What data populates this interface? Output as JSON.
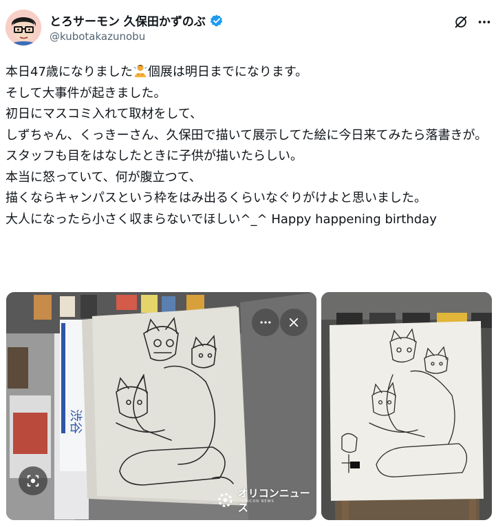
{
  "header": {
    "display_name": "とろサーモン 久保田かずのぶ",
    "handle": "@kubotakazunobu"
  },
  "tweet": {
    "line1_before_emoji": "本日47歳になりました",
    "line1_after_emoji": "個展は明日までになります。",
    "line2": "そして大事件が起きました。",
    "line3": "初日にマスコミ入れて取材をして、",
    "line4": "しずちゃん、くっきーさん、久保田で描いて展示してた絵に今日来てみたら落書きが。",
    "line5": "スタッフも目をはなしたときに子供が描いたらしい。",
    "line6": "本当に怒っていて、何が腹立つて、",
    "line7": "描くならキャンパスという枠をはみ出るくらいなぐりがけよと思いました。",
    "line8": "大人になったら小さく収まらないでほしい^_^ Happy happening birthday"
  },
  "media": {
    "watermark": "オリコンニュース",
    "watermark_sub": "ORICON NEWS"
  },
  "icons": {
    "verified": "verified-badge-icon",
    "grok": "grok-icon",
    "more": "more-dots-icon",
    "close": "close-icon",
    "lens": "visual-search-icon",
    "emoji": "person-bowing-emoji"
  },
  "colors": {
    "verified": "#1d9bf0",
    "text": "#0f1419",
    "secondary": "#536471"
  }
}
